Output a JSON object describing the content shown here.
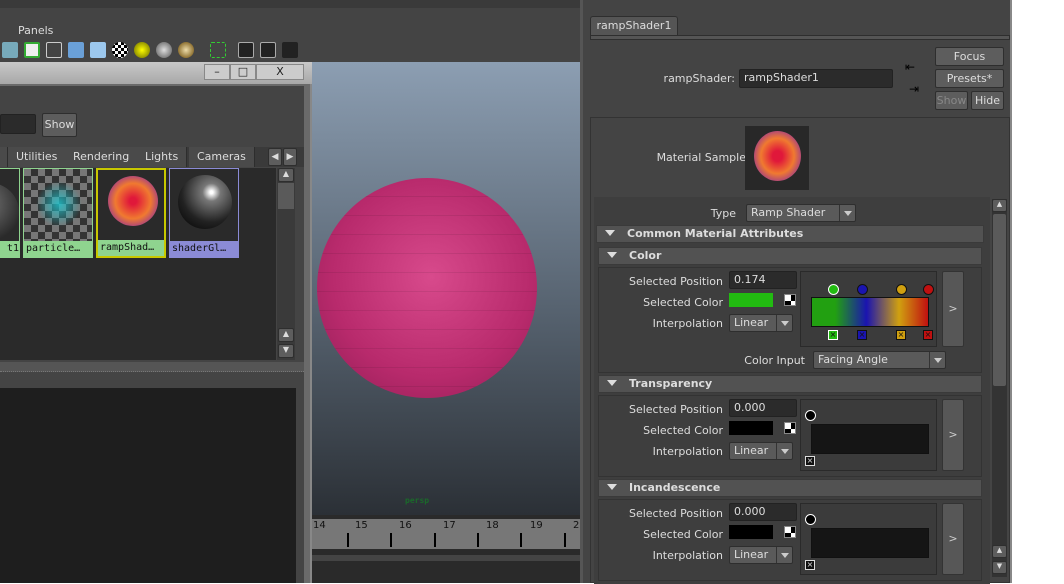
{
  "menubar": {
    "items": [
      "Panels"
    ]
  },
  "hypershade": {
    "window_controls": {
      "minimize": "–",
      "maximize": "□",
      "close": "X"
    },
    "show_button": "Show",
    "tabs": [
      "Utilities",
      "Rendering",
      "Lights",
      "Cameras"
    ],
    "swatches": [
      {
        "label": "t1",
        "color": "#8fd48f"
      },
      {
        "label": "particle…",
        "color": "#8fd48f"
      },
      {
        "label": "rampShad…",
        "color": "#8fd48f"
      },
      {
        "label": "shaderGl…",
        "color": "#8b8bd6"
      }
    ]
  },
  "viewport": {
    "camera_label": "persp",
    "sphere_color": "#c83a7e"
  },
  "timeslider": {
    "ticks": [
      "14",
      "15",
      "16",
      "17",
      "18",
      "19",
      "2"
    ]
  },
  "attribute_editor": {
    "tab": "rampShader1",
    "node_label": "rampShader:",
    "node_name": "rampShader1",
    "focus": "Focus",
    "presets": "Presets*",
    "show": "Show",
    "hide": "Hide",
    "material_sample_label": "Material Sample",
    "type_label": "Type",
    "type_value": "Ramp Shader",
    "sections": {
      "common": "Common Material Attributes",
      "color": {
        "title": "Color",
        "selected_position_label": "Selected Position",
        "selected_position": "0.174",
        "selected_color_label": "Selected Color",
        "selected_color": "#22bb11",
        "interpolation_label": "Interpolation",
        "interpolation": "Linear",
        "color_input_label": "Color Input",
        "color_input": "Facing Angle",
        "ramp_colors": [
          "#22bb11",
          "#1a14b0",
          "#d0a010",
          "#c01010"
        ],
        "expand": ">"
      },
      "transparency": {
        "title": "Transparency",
        "selected_position_label": "Selected Position",
        "selected_position": "0.000",
        "selected_color_label": "Selected Color",
        "selected_color": "#000000",
        "interpolation_label": "Interpolation",
        "interpolation": "Linear",
        "expand": ">"
      },
      "incandescence": {
        "title": "Incandescence",
        "selected_position_label": "Selected Position",
        "selected_position": "0.000",
        "selected_color_label": "Selected Color",
        "selected_color": "#000000",
        "interpolation_label": "Interpolation",
        "interpolation": "Linear",
        "expand": ">"
      }
    }
  }
}
